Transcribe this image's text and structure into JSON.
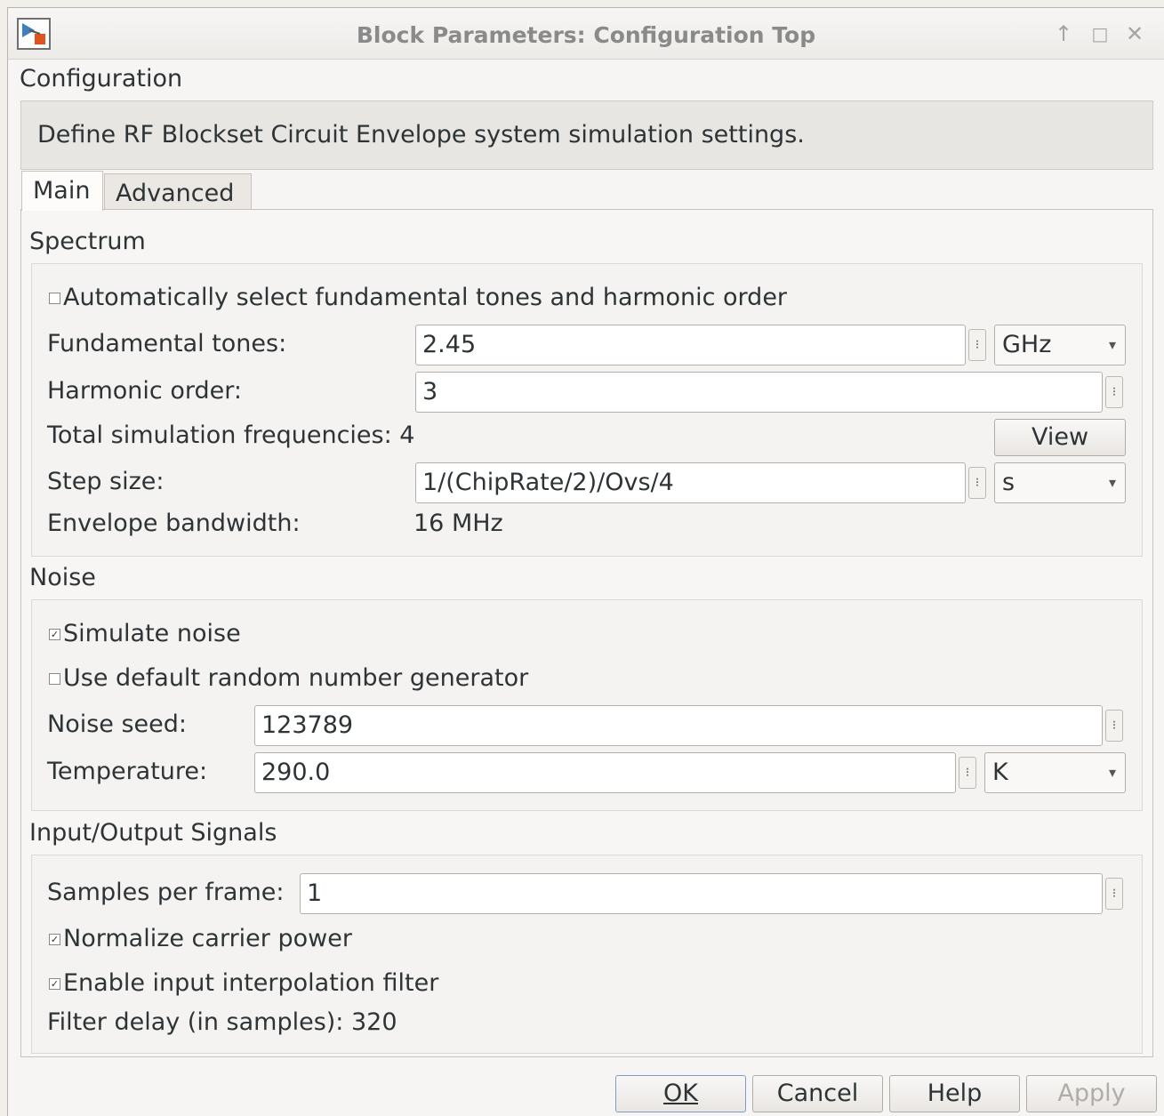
{
  "window": {
    "title": "Block Parameters: Configuration Top",
    "controls": {
      "pin": "↑",
      "maximize": "□",
      "close": "✕"
    }
  },
  "header": {
    "heading": "Configuration",
    "description": "Define RF Blockset Circuit Envelope system simulation settings."
  },
  "tabs": [
    {
      "label": "Main",
      "active": true
    },
    {
      "label": "Advanced",
      "active": false
    }
  ],
  "spectrum": {
    "heading": "Spectrum",
    "auto_select_label": "Automatically select fundamental tones and harmonic order",
    "auto_select_checked": false,
    "fundamental_tones_label": "Fundamental tones:",
    "fundamental_tones_value": "2.45",
    "fundamental_tones_unit": "GHz",
    "harmonic_order_label": "Harmonic order:",
    "harmonic_order_value": "3",
    "total_freq_label": "Total simulation frequencies: 4",
    "view_button": "View",
    "step_size_label": "Step size:",
    "step_size_value": "1/(ChipRate/2)/Ovs/4",
    "step_size_unit": "s",
    "envelope_bw_label": "Envelope bandwidth:",
    "envelope_bw_value": "16 MHz"
  },
  "noise": {
    "heading": "Noise",
    "simulate_noise_label": "Simulate noise",
    "simulate_noise_checked": true,
    "default_rng_label": "Use default random number generator",
    "default_rng_checked": false,
    "noise_seed_label": "Noise seed:",
    "noise_seed_value": "123789",
    "temperature_label": "Temperature:",
    "temperature_value": "290.0",
    "temperature_unit": "K"
  },
  "io": {
    "heading": "Input/Output Signals",
    "samples_per_frame_label": "Samples per frame:",
    "samples_per_frame_value": "1",
    "normalize_label": "Normalize carrier power",
    "normalize_checked": true,
    "interp_filter_label": "Enable input interpolation filter",
    "interp_filter_checked": true,
    "filter_delay_label": "Filter delay (in samples): 320"
  },
  "buttons": {
    "ok": "OK",
    "cancel": "Cancel",
    "help": "Help",
    "apply": "Apply"
  },
  "icons": {
    "caret": "▾",
    "more": "⁝",
    "check": "✓"
  }
}
